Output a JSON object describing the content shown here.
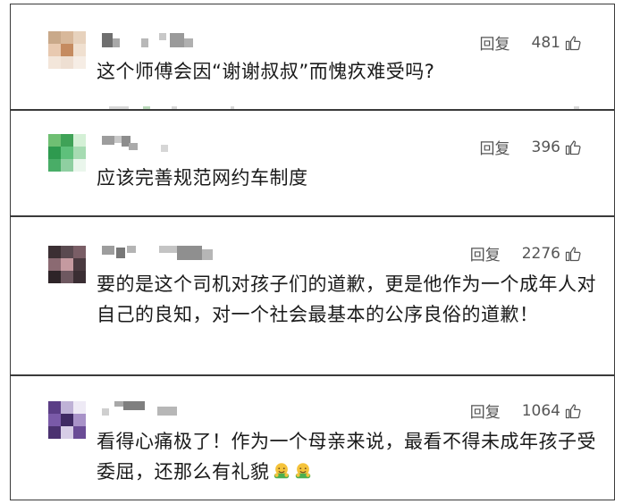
{
  "comments": [
    {
      "reply_label": "回复",
      "likes": "481",
      "text": "这个师傅会因“谢谢叔叔”而愧疚难受吗?"
    },
    {
      "reply_label": "回复",
      "likes": "396",
      "text": "应该完善规范网约车制度"
    },
    {
      "reply_label": "回复",
      "likes": "2276",
      "text": "要的是这个司机对孩子们的道歉，更是他作为一个成年人对自己的良知，对一个社会最基本的公序良俗的道歉！"
    },
    {
      "reply_label": "回复",
      "likes": "1064",
      "text": "看得心痛极了！作为一个母亲来说，最看不得未成年孩子受委屈，还那么有礼貌"
    }
  ],
  "icons": {
    "like": "thumbs-up-icon",
    "emoji": "hugging-face-emoji"
  },
  "colors": {
    "text": "#1a1a1a",
    "meta": "#555555",
    "border": "#3a3a3a"
  }
}
